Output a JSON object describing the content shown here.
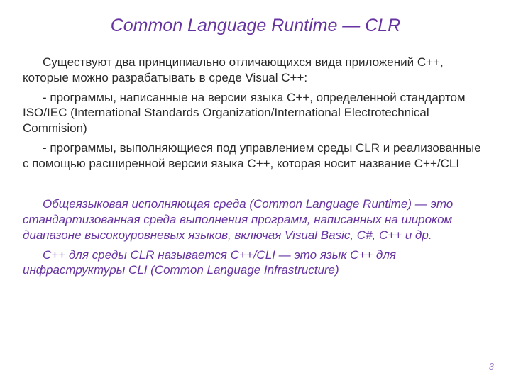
{
  "title": "Common Language Runtime — CLR",
  "paragraphs": {
    "p1": "Существуют два принципиально отличающихся вида приложений С++, которые можно разрабатывать в среде Visual C++:",
    "p2": " - программы, написанные на версии языка С++, определенной стандартом ISO/IEC (International Standards Organization/International Electrotechnical Commision)",
    "p3": "- программы, выполняющиеся под управлением среды CLR и реализованные с помощью расширенной версии языка С++, которая носит название C++/CLI",
    "p4": "Общеязыковая исполняющая среда (Common Language Runtime) — это стандартизованная среда выполнения программ, написанных на широком диапазоне высокоуровневых языков, включая Visual Basic, C#, C++ и др.",
    "p5": "С++ для среды CLR называется C++/CLI — это язык С++ для инфраструктуры CLI (Common Language Infrastructure)"
  },
  "page_number": "3"
}
